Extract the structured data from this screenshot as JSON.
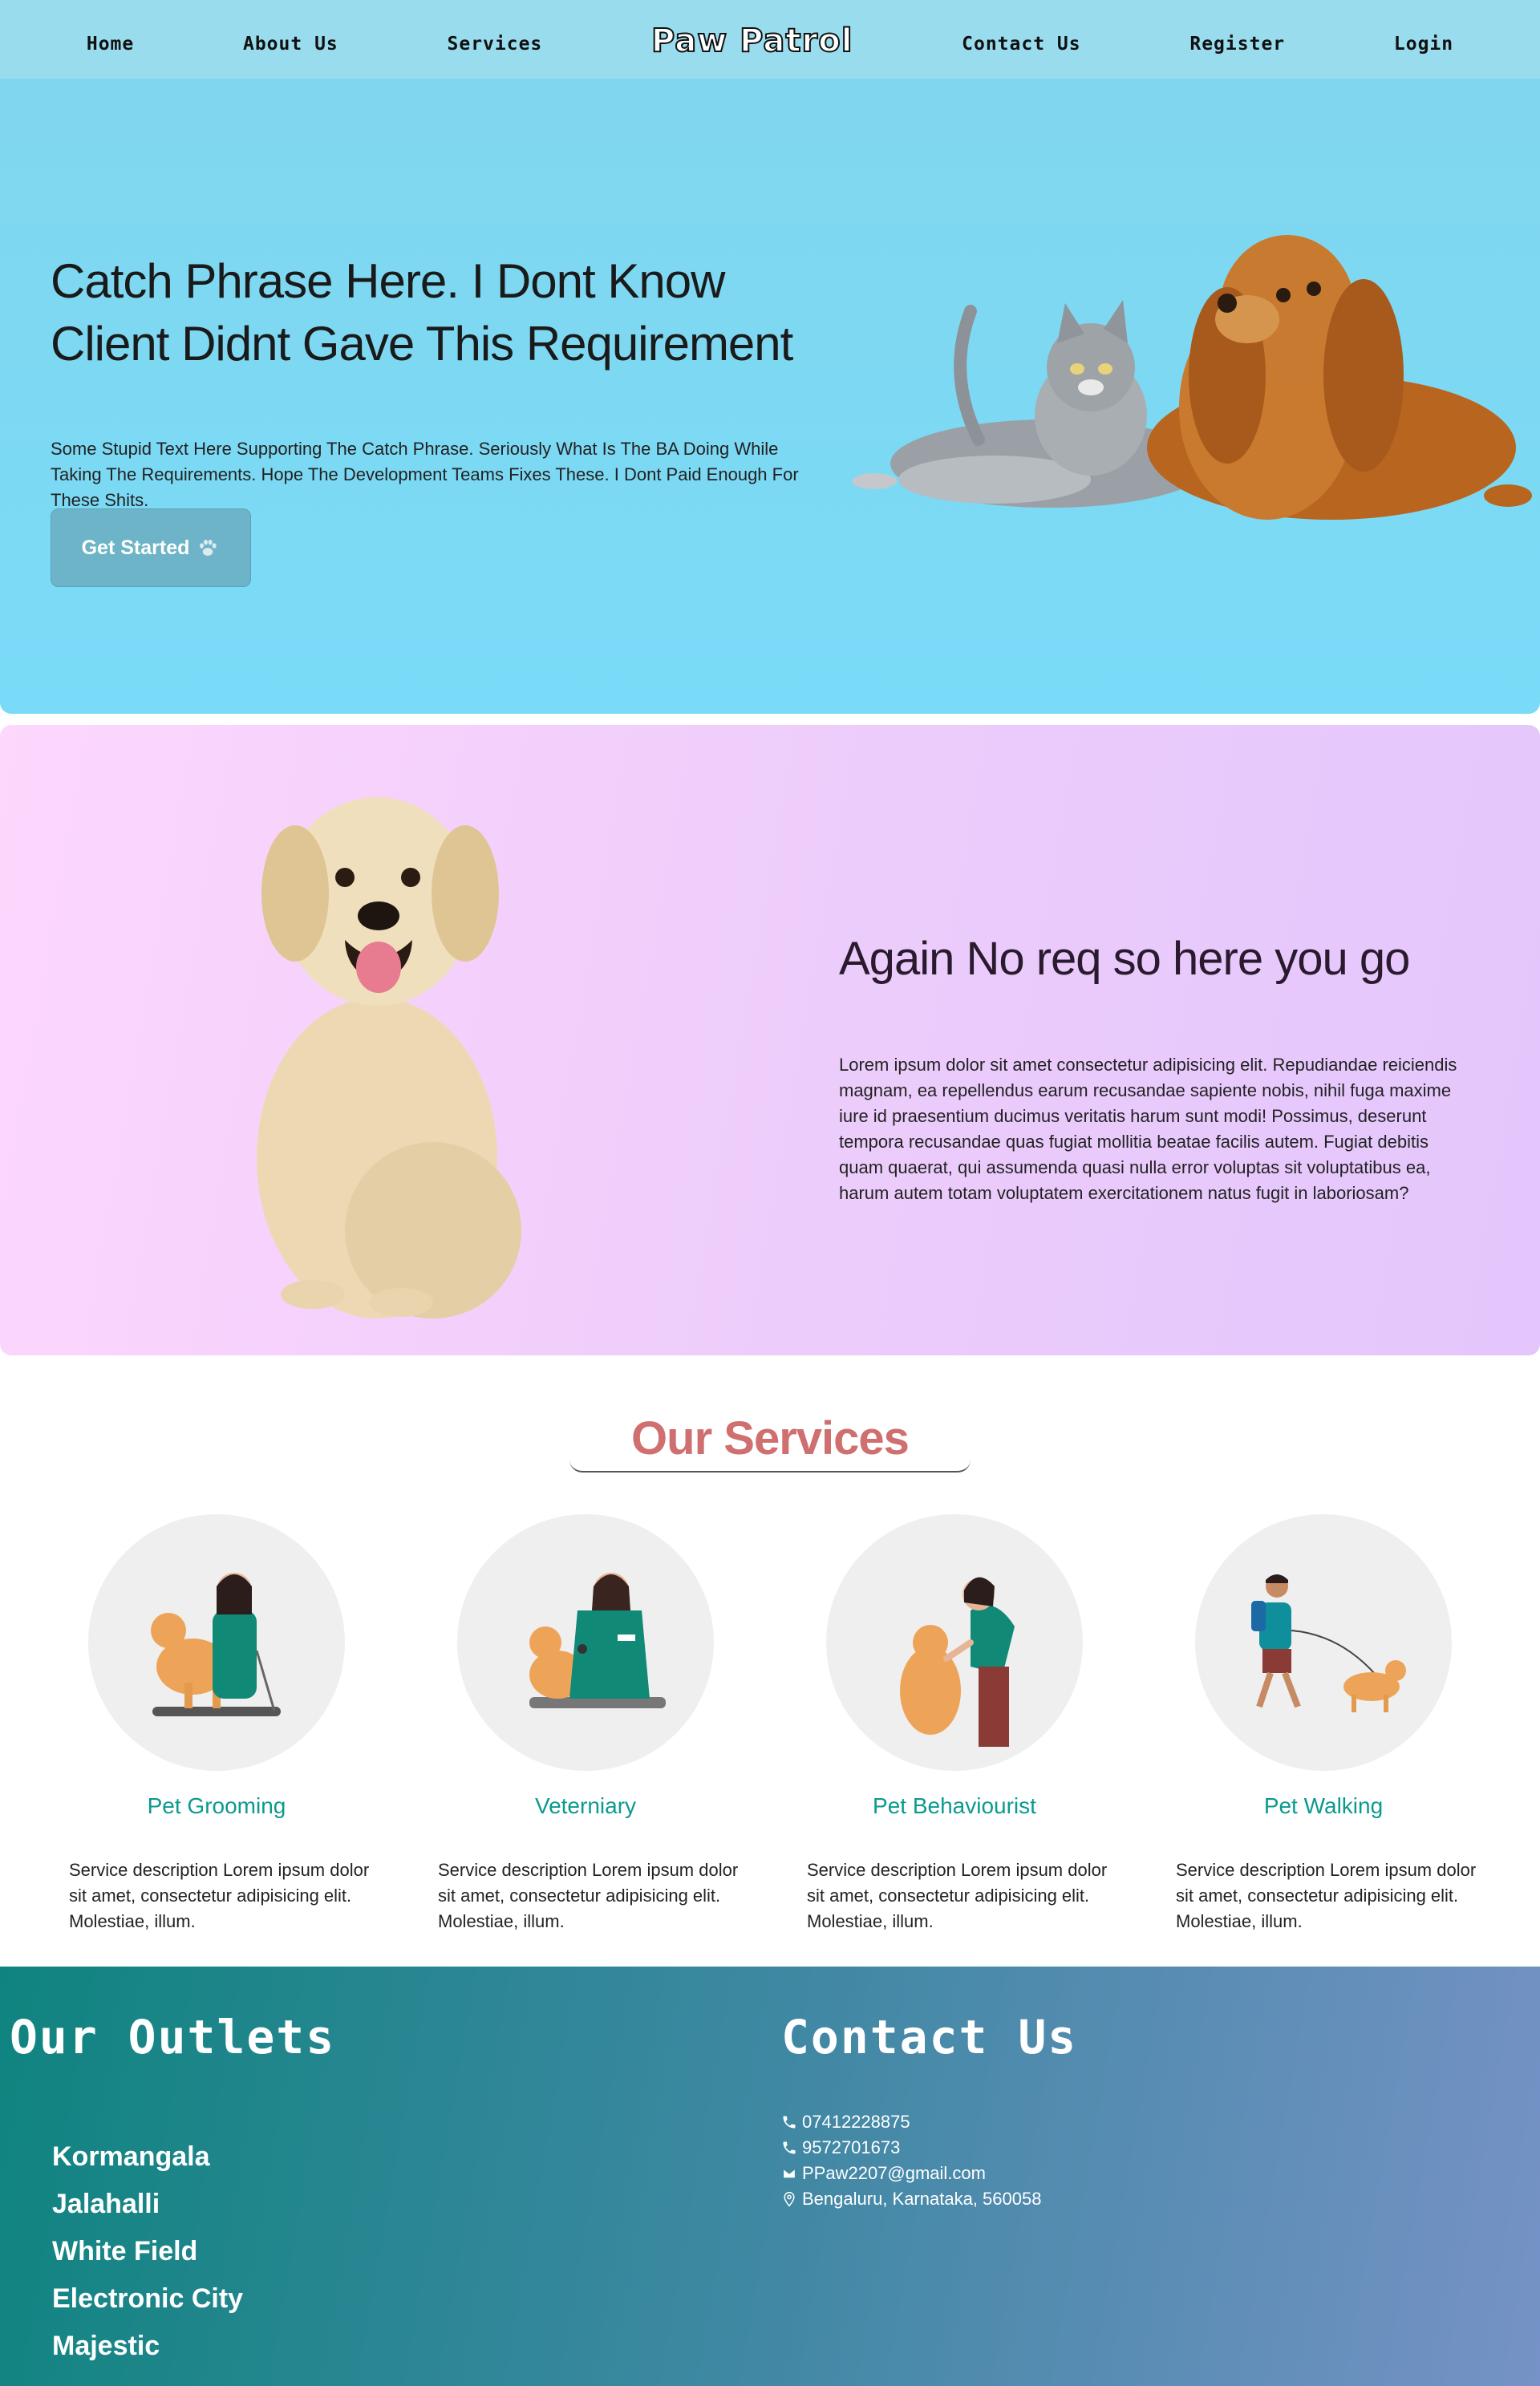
{
  "nav": {
    "home": "Home",
    "about": "About Us",
    "services": "Services",
    "logo": "Paw Patrol",
    "contact": "Contact Us",
    "register": "Register",
    "login": "Login"
  },
  "hero": {
    "headline": "Catch Phrase Here. I Dont Know Client Didnt Gave This Requirement",
    "subtext": "Some Stupid Text Here Supporting The Catch Phrase. Seriously What Is The BA Doing While Taking The Requirements. Hope The Development Teams Fixes These. I Dont Paid Enough For These Shits.",
    "cta_label": "Get Started"
  },
  "about": {
    "heading": "Again No req so here you go",
    "body": "Lorem ipsum dolor sit amet consectetur adipisicing elit. Repudiandae reiciendis magnam, ea repellendus earum recusandae sapiente nobis, nihil fuga maxime iure id praesentium ducimus veritatis harum sunt modi! Possimus, deserunt tempora recusandae quas fugiat mollitia beatae facilis autem. Fugiat debitis quam quaerat, qui assumenda quasi nulla error voluptas sit voluptatibus ea, harum autem totam voluptatem exercitationem natus fugit in laboriosam?"
  },
  "services": {
    "title": "Our Services",
    "items": [
      {
        "name": "Pet Grooming",
        "desc": "Service description Lorem ipsum dolor sit amet, consectetur adipisicing elit. Molestiae, illum."
      },
      {
        "name": "Veterniary",
        "desc": "Service description Lorem ipsum dolor sit amet, consectetur adipisicing elit. Molestiae, illum."
      },
      {
        "name": "Pet Behaviourist",
        "desc": "Service description Lorem ipsum dolor sit amet, consectetur adipisicing elit. Molestiae, illum."
      },
      {
        "name": "Pet Walking",
        "desc": "Service description Lorem ipsum dolor sit amet, consectetur adipisicing elit. Molestiae, illum."
      }
    ]
  },
  "footer": {
    "outlets_title": "Our Outlets",
    "outlets": [
      "Kormangala",
      "Jalahalli",
      "White Field",
      "Electronic City",
      "Majestic"
    ],
    "contact_title": "Contact Us",
    "phone1": "07412228875",
    "phone2": "9572701673",
    "email": "PPaw2207@gmail.com",
    "address": "Bengaluru, Karnataka, 560058"
  },
  "colors": {
    "nav_bg": "#98dcee",
    "hero_bg": "#7adbf8",
    "about_bg": "#ecccfb",
    "services_title": "#cf6f6f",
    "service_name": "#0b9a8f",
    "footer_start": "#0f847f",
    "footer_end": "#7692c6"
  }
}
